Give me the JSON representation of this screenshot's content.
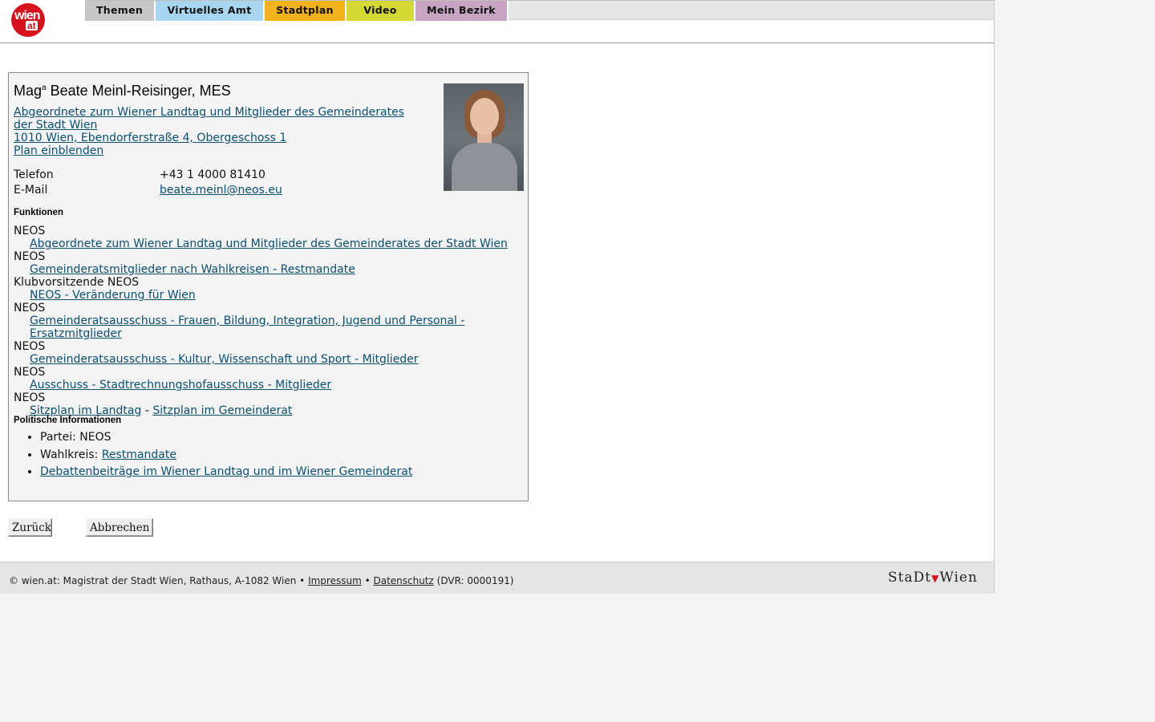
{
  "header": {
    "logo_top": "wien",
    "logo_bottom": "at",
    "tabs": [
      {
        "label": "Themen",
        "color": "#c7c7c7"
      },
      {
        "label": "Virtuelles Amt",
        "color": "#a8d5f0"
      },
      {
        "label": "Stadtplan",
        "color": "#f2b21c"
      },
      {
        "label": "Video",
        "color": "#d4d835"
      },
      {
        "label": "Mein Bezirk",
        "color": "#c9a5c4"
      }
    ]
  },
  "person": {
    "name_prefix": "Mag",
    "name_sup": "a",
    "name_rest": " Beate Meinl-Reisinger, MES",
    "org_line1": "Abgeordnete zum Wiener Landtag und Mitglieder des Gemeinderates der Stadt Wien ",
    "address": "1010 Wien, Ebendorferstraße 4, Obergeschoss 1",
    "plan_link": "Plan einblenden",
    "phone_label": "Telefon",
    "phone_value": "+43 1 4000 81410",
    "email_label": "E-Mail",
    "email_value": "beate.meinl@neos.eu"
  },
  "functions": {
    "heading": "Funktionen",
    "items": [
      {
        "party": "NEOS",
        "link": "Abgeordnete zum Wiener Landtag und Mitglieder des Gemeinderates der Stadt Wien"
      },
      {
        "party": "NEOS",
        "link": "Gemeinderatsmitglieder nach Wahlkreisen - Restmandate"
      },
      {
        "party": "Klubvorsitzende NEOS",
        "link": "NEOS - Veränderung für Wien"
      },
      {
        "party": "NEOS",
        "link": "Gemeinderatsausschuss - Frauen, Bildung, Integration, Jugend und Personal - Ersatzmitglieder"
      },
      {
        "party": "NEOS",
        "link": "Gemeinderatsausschuss - Kultur, Wissenschaft und Sport - Mitglieder"
      },
      {
        "party": "NEOS",
        "link": "Ausschuss - Stadtrechnungshofausschuss - Mitglieder"
      }
    ],
    "last_party": "NEOS",
    "seat_link_1": "Sitzplan im Landtag",
    "seat_sep": " - ",
    "seat_link_2": "Sitzplan im Gemeinderat"
  },
  "political": {
    "heading": "Politische Informationen",
    "party_text": "Partei: NEOS",
    "district_label": "Wahlkreis: ",
    "district_link": "Restmandate",
    "debate_link": "Debattenbeiträge im Wiener Landtag und im Wiener Gemeinderat"
  },
  "buttons": {
    "back": "Zurück",
    "cancel": "Abbrechen"
  },
  "footer": {
    "copyright": "© wien.at: Magistrat der Stadt Wien, Rathaus, A-1082 Wien • ",
    "impressum": "Impressum",
    "sep": " • ",
    "datenschutz": "Datenschutz",
    "dvr": " (DVR: 0000191)",
    "brand_left": "StaDt",
    "brand_right": "Wien"
  }
}
